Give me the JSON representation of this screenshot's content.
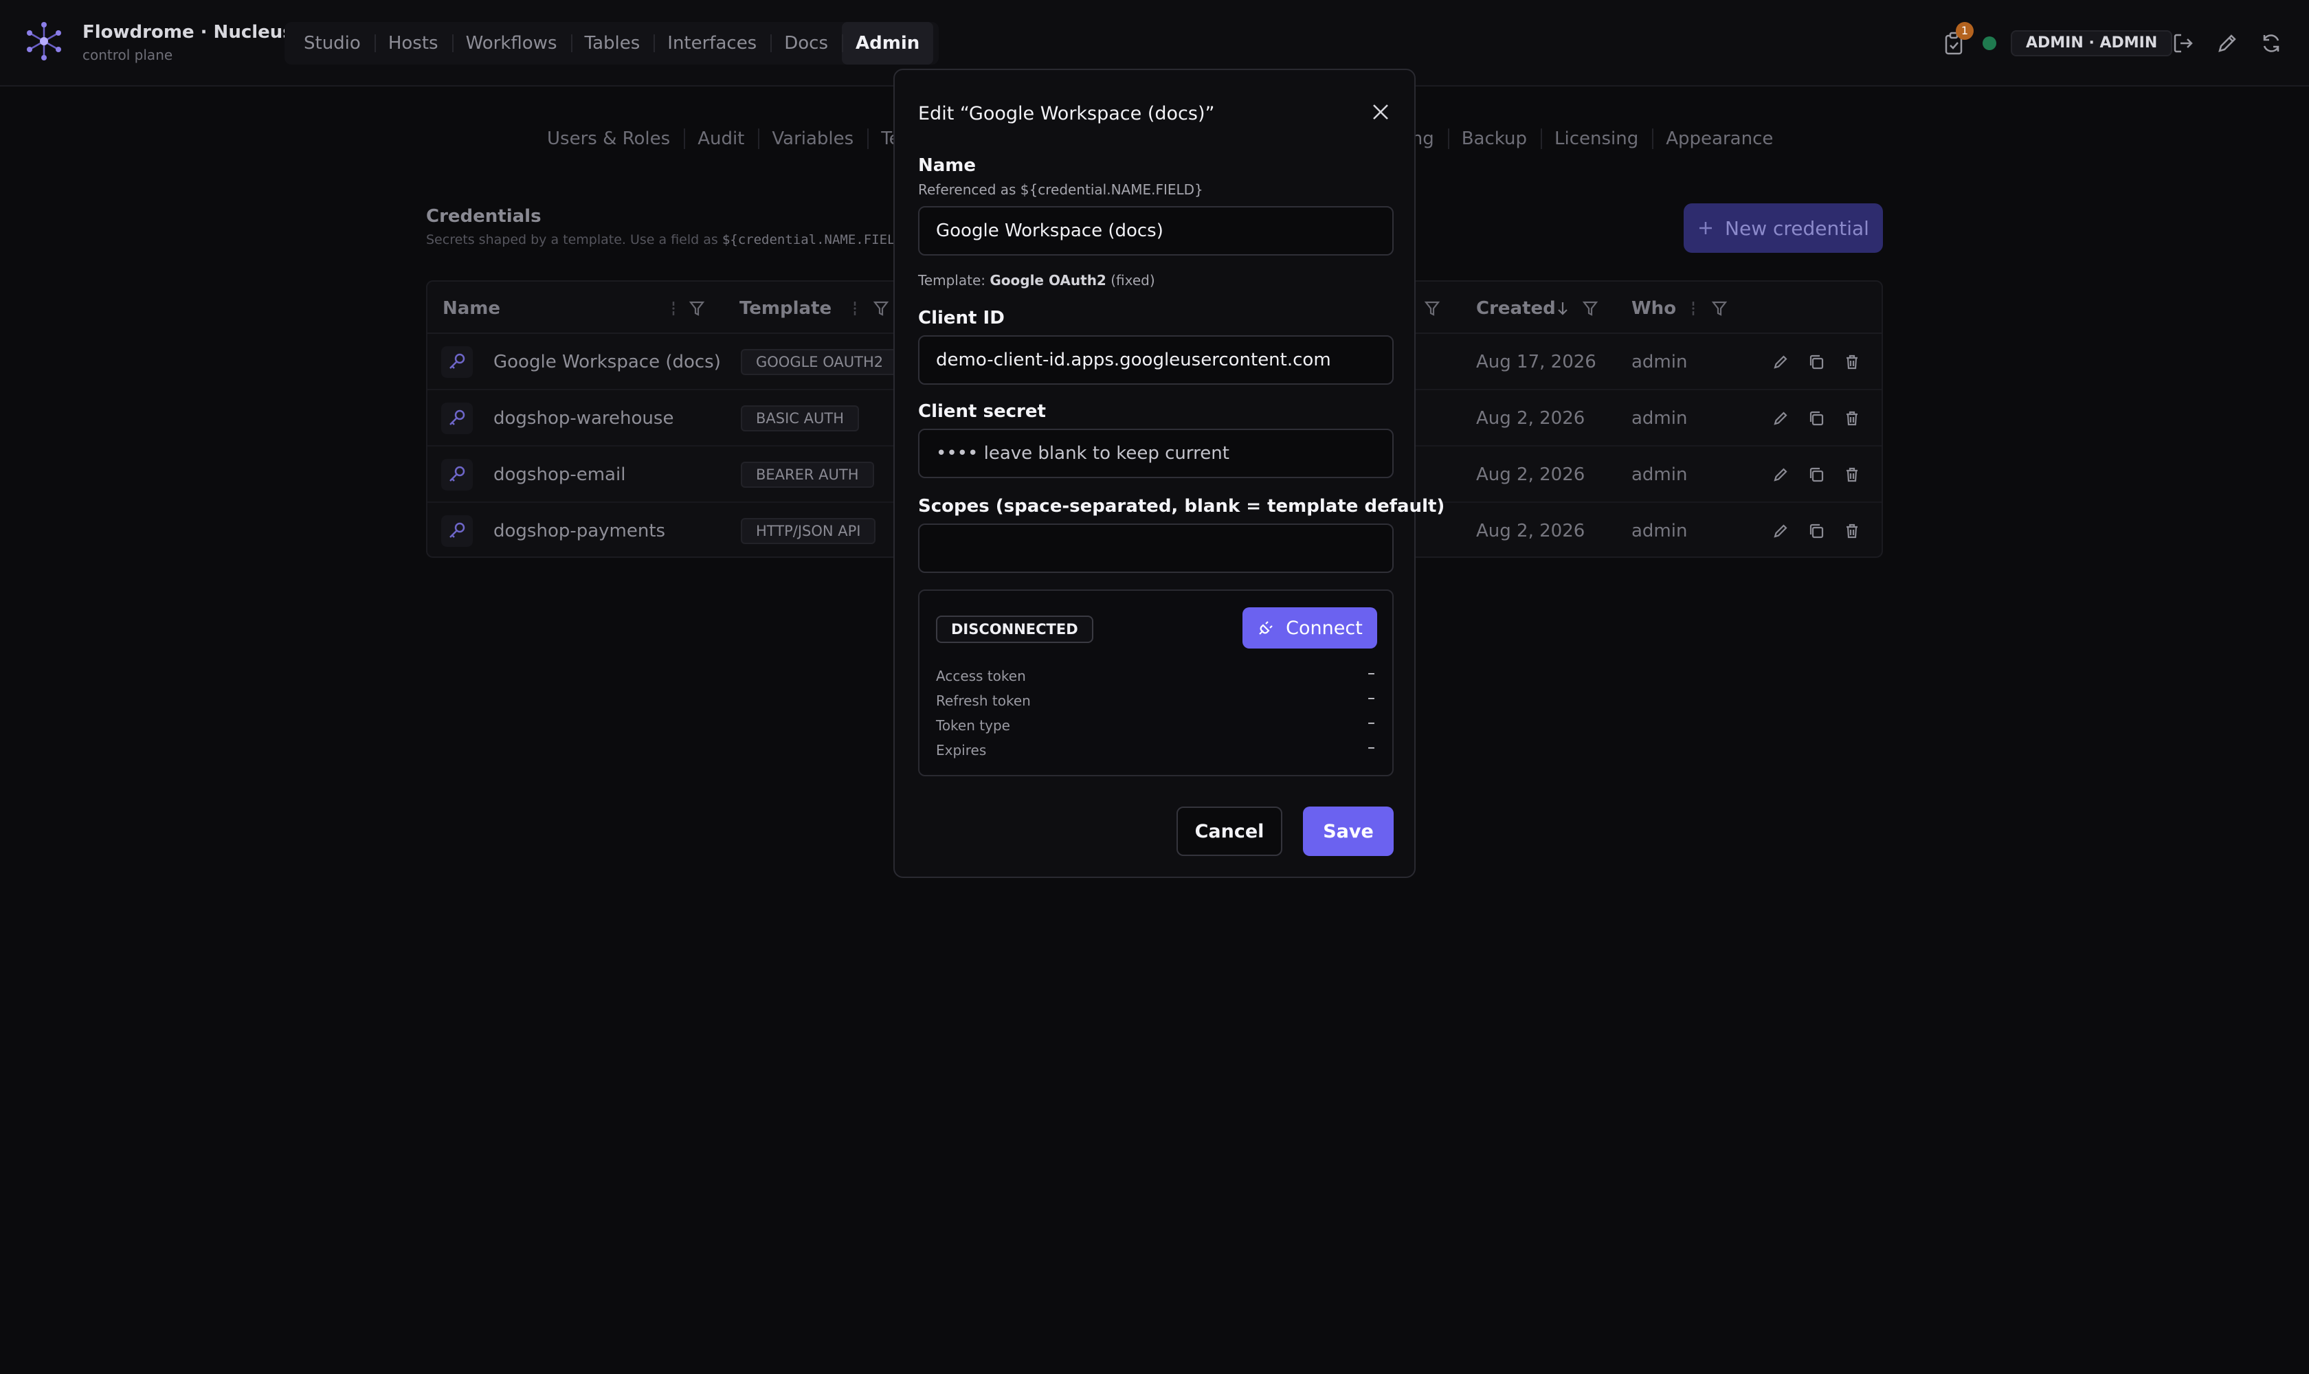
{
  "app": {
    "title": "Flowdrome · Nucleus",
    "subtitle": "control plane",
    "user_label": "ADMIN · ADMIN",
    "task_badge": "1"
  },
  "nav": {
    "items": [
      {
        "label": "Studio"
      },
      {
        "label": "Hosts"
      },
      {
        "label": "Workflows"
      },
      {
        "label": "Tables"
      },
      {
        "label": "Interfaces"
      },
      {
        "label": "Docs"
      },
      {
        "label": "Admin"
      }
    ]
  },
  "subnav": {
    "left": [
      {
        "label": "Users & Roles"
      },
      {
        "label": "Audit"
      },
      {
        "label": "Variables"
      },
      {
        "label": "Tena"
      }
    ],
    "right": [
      {
        "label": "ging"
      },
      {
        "label": "Backup"
      },
      {
        "label": "Licensing"
      },
      {
        "label": "Appearance"
      }
    ]
  },
  "section": {
    "title": "Credentials",
    "subtitle_prefix": "Secrets shaped by a template. Use a field as ",
    "subtitle_code": "${credential.NAME.FIELD}",
    "new_button": "New credential"
  },
  "table": {
    "headers": {
      "name": "Name",
      "template": "Template",
      "created": "Created",
      "who": "Who"
    },
    "rows": [
      {
        "name": "Google Workspace (docs)",
        "template": "GOOGLE OAUTH2",
        "created": "Aug 17, 2026",
        "who": "admin"
      },
      {
        "name": "dogshop-warehouse",
        "template": "BASIC AUTH",
        "created": "Aug 2, 2026",
        "who": "admin"
      },
      {
        "name": "dogshop-email",
        "template": "BEARER AUTH",
        "created": "Aug 2, 2026",
        "who": "admin"
      },
      {
        "name": "dogshop-payments",
        "template": "HTTP/JSON API",
        "created": "Aug 2, 2026",
        "who": "admin"
      }
    ]
  },
  "modal": {
    "title": "Edit “Google Workspace (docs)”",
    "name_label": "Name",
    "name_hint": "Referenced as ${credential.NAME.FIELD}",
    "name_value": "Google Workspace (docs)",
    "template_prefix": "Template: ",
    "template_name": "Google OAuth2",
    "template_suffix": " (fixed)",
    "client_id_label": "Client ID",
    "client_id_value": "demo-client-id.apps.googleusercontent.com",
    "client_secret_label": "Client secret",
    "client_secret_placeholder": "•••• leave blank to keep current",
    "scopes_label": "Scopes (space-separated, blank = template default)",
    "scopes_value": "",
    "status_badge": "DISCONNECTED",
    "connect_label": "Connect",
    "tokens": [
      {
        "key": "Access token",
        "value": "–"
      },
      {
        "key": "Refresh token",
        "value": "–"
      },
      {
        "key": "Token type",
        "value": "–"
      },
      {
        "key": "Expires",
        "value": "–"
      }
    ],
    "cancel_label": "Cancel",
    "save_label": "Save"
  },
  "colors": {
    "accent": "#6b62f0",
    "accent_dim": "#2e2c6e",
    "status_online": "#1f7a4f",
    "badge": "#b4631f"
  }
}
